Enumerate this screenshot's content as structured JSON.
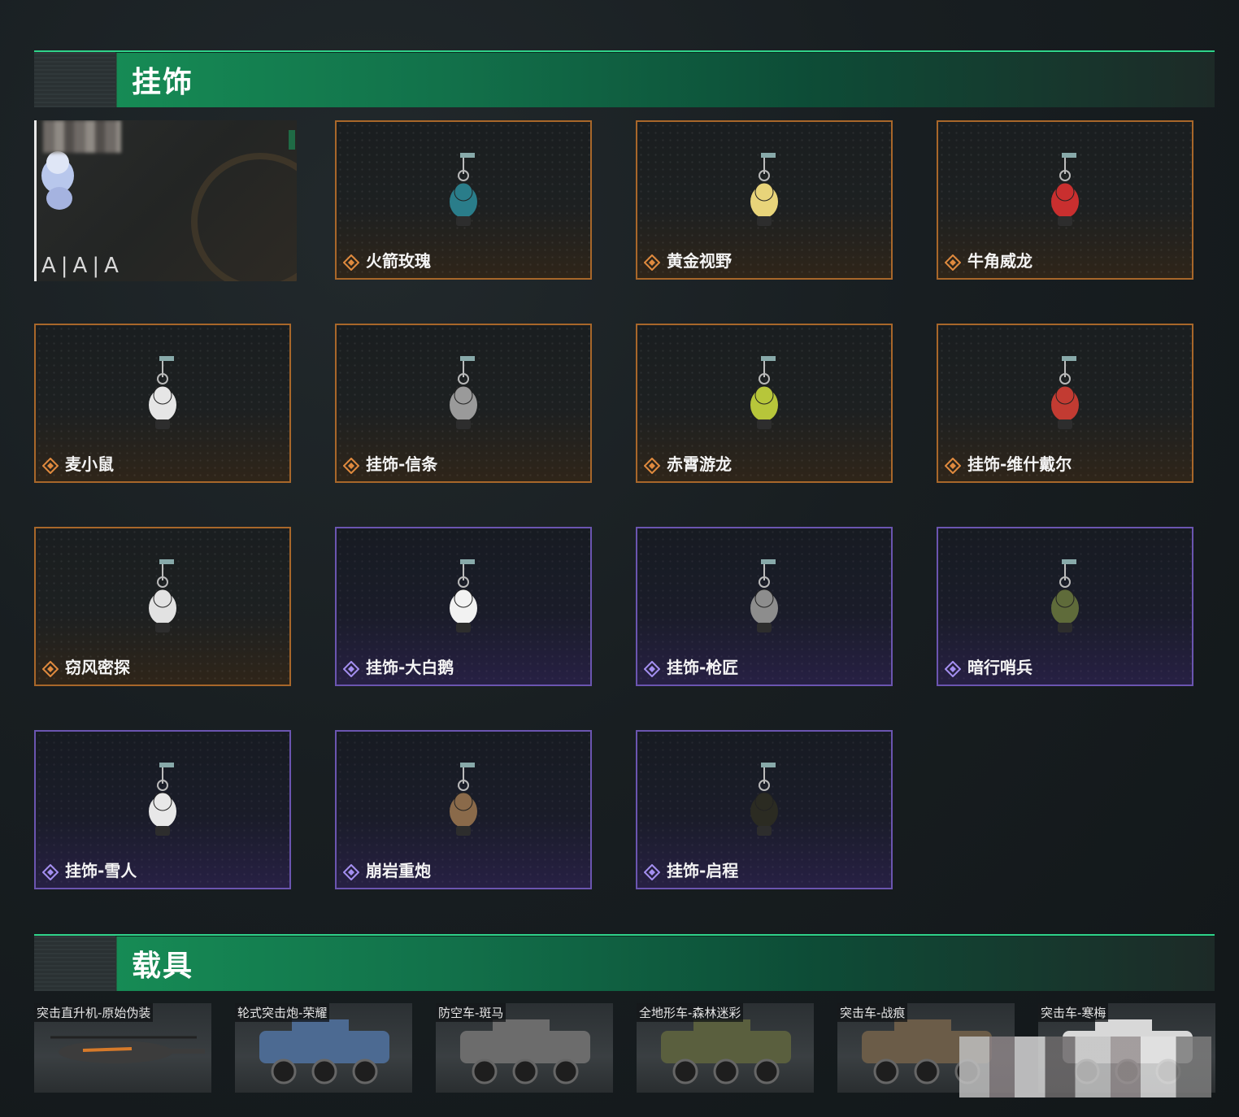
{
  "sections": {
    "charms_title": "挂饰",
    "vehicles_title": "载具"
  },
  "featured": {
    "tag": "A|A|A"
  },
  "charms": [
    {
      "name": "火箭玫瑰",
      "rarity": "orange"
    },
    {
      "name": "黄金视野",
      "rarity": "orange"
    },
    {
      "name": "牛角威龙",
      "rarity": "orange"
    },
    {
      "name": "麦小鼠",
      "rarity": "orange"
    },
    {
      "name": "挂饰-信条",
      "rarity": "orange"
    },
    {
      "name": "赤霄游龙",
      "rarity": "orange"
    },
    {
      "name": "挂饰-维什戴尔",
      "rarity": "orange"
    },
    {
      "name": "窃风密探",
      "rarity": "orange"
    },
    {
      "name": "挂饰-大白鹅",
      "rarity": "purple"
    },
    {
      "name": "挂饰-枪匠",
      "rarity": "purple"
    },
    {
      "name": "暗行哨兵",
      "rarity": "purple"
    },
    {
      "name": "挂饰-雪人",
      "rarity": "purple"
    },
    {
      "name": "崩岩重炮",
      "rarity": "purple"
    },
    {
      "name": "挂饰-启程",
      "rarity": "purple"
    }
  ],
  "vehicles": [
    {
      "name": "突击直升机-原始伪装"
    },
    {
      "name": "轮式突击炮-荣耀"
    },
    {
      "name": "防空车-斑马"
    },
    {
      "name": "全地形车-森林迷彩"
    },
    {
      "name": "突击车-战痕"
    },
    {
      "name": "突击车-寒梅"
    }
  ],
  "colors": {
    "orange_border": "#a8672a",
    "purple_border": "#6b55b0",
    "header_green": "#168b55"
  }
}
